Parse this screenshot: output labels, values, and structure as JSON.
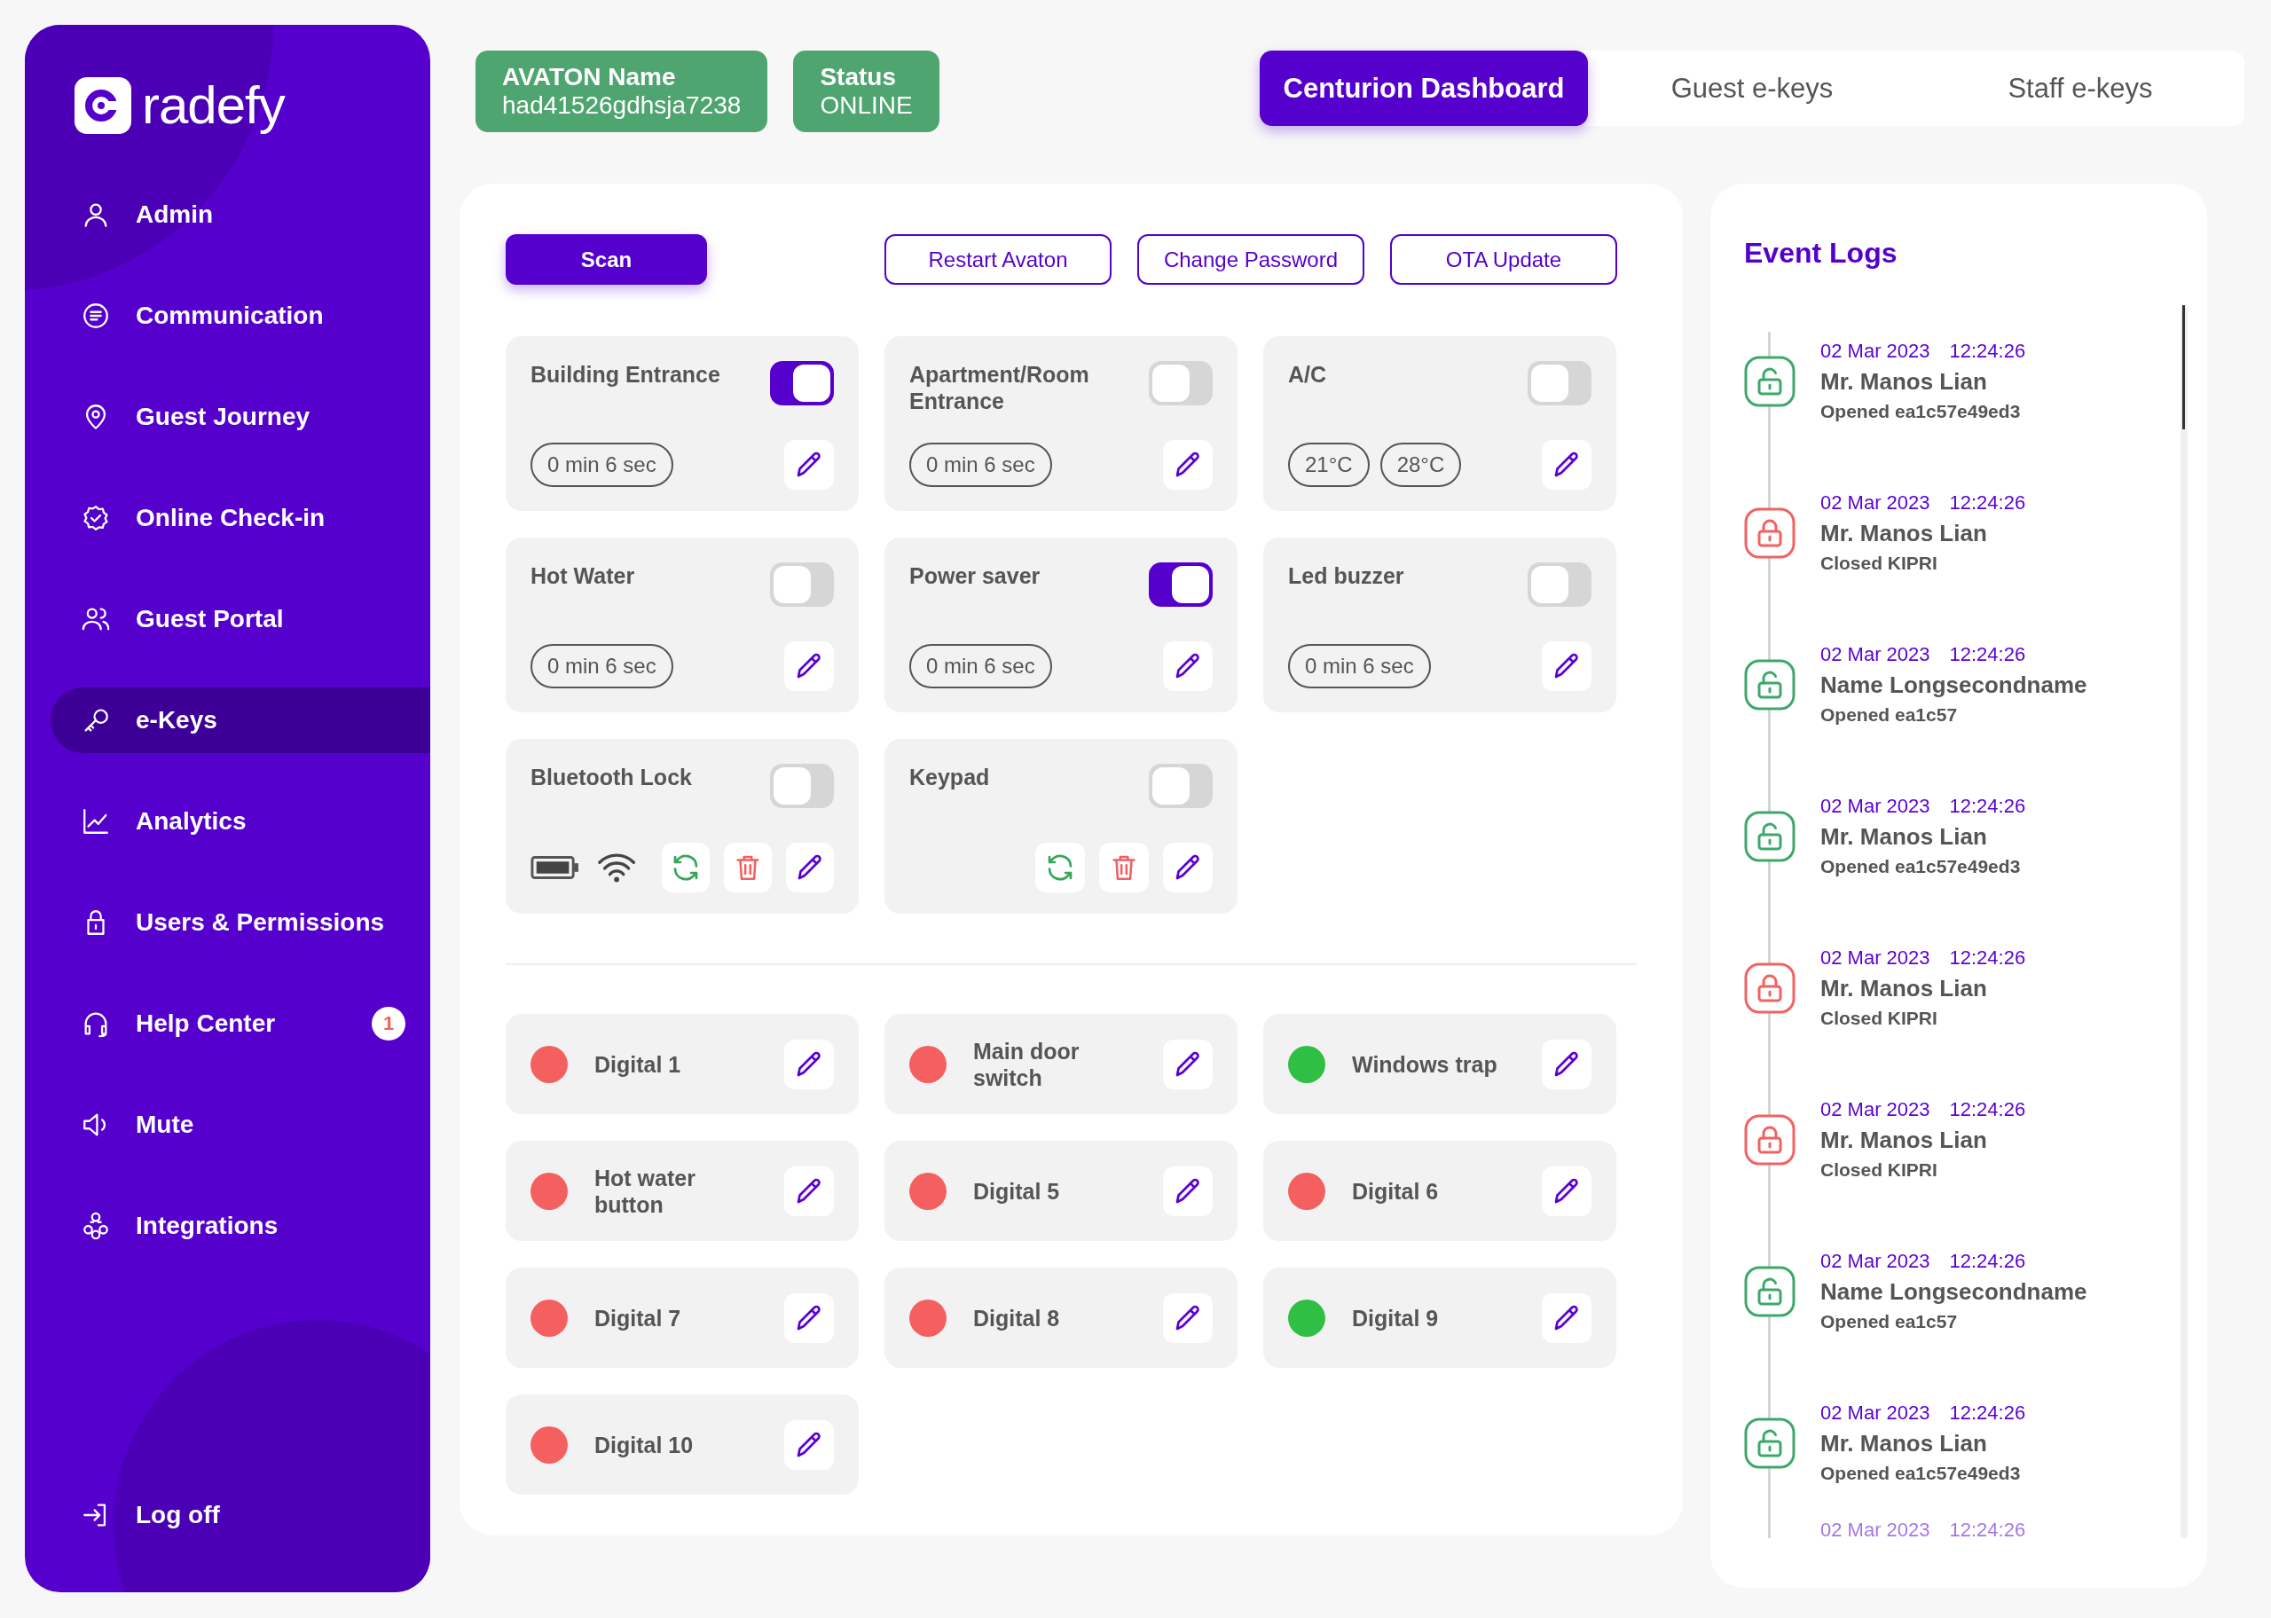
{
  "brand": {
    "name": "radefy"
  },
  "sidebar": {
    "items": [
      {
        "label": "Admin",
        "selected": false
      },
      {
        "label": "Communication",
        "selected": false
      },
      {
        "label": "Guest Journey",
        "selected": false
      },
      {
        "label": "Online Check-in",
        "selected": false
      },
      {
        "label": "Guest Portal",
        "selected": false
      },
      {
        "label": "e-Keys",
        "selected": true
      },
      {
        "label": "Analytics",
        "selected": false
      },
      {
        "label": "Users & Permissions",
        "selected": false
      },
      {
        "label": "Help Center",
        "selected": false,
        "badge": "1"
      },
      {
        "label": "Mute",
        "selected": false
      },
      {
        "label": "Integrations",
        "selected": false
      }
    ],
    "logoff": {
      "label": "Log off"
    }
  },
  "info_cards": [
    {
      "label": "AVATON Name",
      "value": "had41526gdhsja7238"
    },
    {
      "label": "Status",
      "value": "ONLINE"
    }
  ],
  "tabs": [
    {
      "label": "Centurion Dashboard",
      "selected": true
    },
    {
      "label": "Guest e-keys",
      "selected": false
    },
    {
      "label": "Staff e-keys",
      "selected": false
    }
  ],
  "actions": [
    {
      "label": "Scan",
      "kind": "primary"
    },
    {
      "label": "Restart Avaton",
      "kind": "outline"
    },
    {
      "label": "Change Password",
      "kind": "outline"
    },
    {
      "label": "OTA Update",
      "kind": "outline"
    }
  ],
  "devices": [
    {
      "name": "Building Entrance",
      "on": true,
      "kind": "timer",
      "chips": [
        "0 min 6 sec"
      ]
    },
    {
      "name": "Apartment/Room Entrance",
      "on": false,
      "kind": "timer",
      "chips": [
        "0 min 6 sec"
      ]
    },
    {
      "name": "A/C",
      "on": false,
      "kind": "timer",
      "chips": [
        "21°C",
        "28°C"
      ]
    },
    {
      "name": "Hot Water",
      "on": false,
      "kind": "timer",
      "chips": [
        "0 min 6 sec"
      ]
    },
    {
      "name": "Power saver",
      "on": true,
      "kind": "timer",
      "chips": [
        "0 min 6 sec"
      ]
    },
    {
      "name": "Led buzzer",
      "on": false,
      "kind": "timer",
      "chips": [
        "0 min 6 sec"
      ]
    },
    {
      "name": "Bluetooth Lock",
      "on": false,
      "kind": "lock"
    },
    {
      "name": "Keypad",
      "on": false,
      "kind": "keypad"
    }
  ],
  "inputs": [
    {
      "name": "Digital 1",
      "color": "#f45f5f"
    },
    {
      "name": "Main door switch",
      "color": "#f45f5f"
    },
    {
      "name": "Windows trap",
      "color": "#2fbf45"
    },
    {
      "name": "Hot water button",
      "color": "#f45f5f"
    },
    {
      "name": "Digital 5",
      "color": "#f45f5f"
    },
    {
      "name": "Digital 6",
      "color": "#f45f5f"
    },
    {
      "name": "Digital 7",
      "color": "#f45f5f"
    },
    {
      "name": "Digital 8",
      "color": "#f45f5f"
    },
    {
      "name": "Digital 9",
      "color": "#2fbf45"
    },
    {
      "name": "Digital 10",
      "color": "#f45f5f"
    }
  ],
  "event_logs": {
    "title": "Event Logs",
    "events": [
      {
        "date": "02 Mar 2023",
        "time": "12:24:26",
        "name": "Mr. Manos Lian",
        "action": "Opened ea1c57e49ed3",
        "kind": "opened"
      },
      {
        "date": "02 Mar 2023",
        "time": "12:24:26",
        "name": "Mr. Manos Lian",
        "action": "Closed KIPRI",
        "kind": "closed"
      },
      {
        "date": "02 Mar 2023",
        "time": "12:24:26",
        "name": "Name Longsecondname",
        "action": "Opened ea1c57",
        "kind": "opened"
      },
      {
        "date": "02 Mar 2023",
        "time": "12:24:26",
        "name": "Mr. Manos Lian",
        "action": "Opened ea1c57e49ed3",
        "kind": "opened"
      },
      {
        "date": "02 Mar 2023",
        "time": "12:24:26",
        "name": "Mr. Manos Lian",
        "action": "Closed KIPRI",
        "kind": "closed"
      },
      {
        "date": "02 Mar 2023",
        "time": "12:24:26",
        "name": "Mr. Manos Lian",
        "action": "Closed KIPRI",
        "kind": "closed"
      },
      {
        "date": "02 Mar 2023",
        "time": "12:24:26",
        "name": "Name Longsecondname",
        "action": "Opened ea1c57",
        "kind": "opened"
      },
      {
        "date": "02 Mar 2023",
        "time": "12:24:26",
        "name": "Mr. Manos Lian",
        "action": "Opened ea1c57e49ed3",
        "kind": "opened"
      },
      {
        "date": "02 Mar 2023",
        "time": "12:24:26",
        "kind": "partial"
      }
    ]
  }
}
